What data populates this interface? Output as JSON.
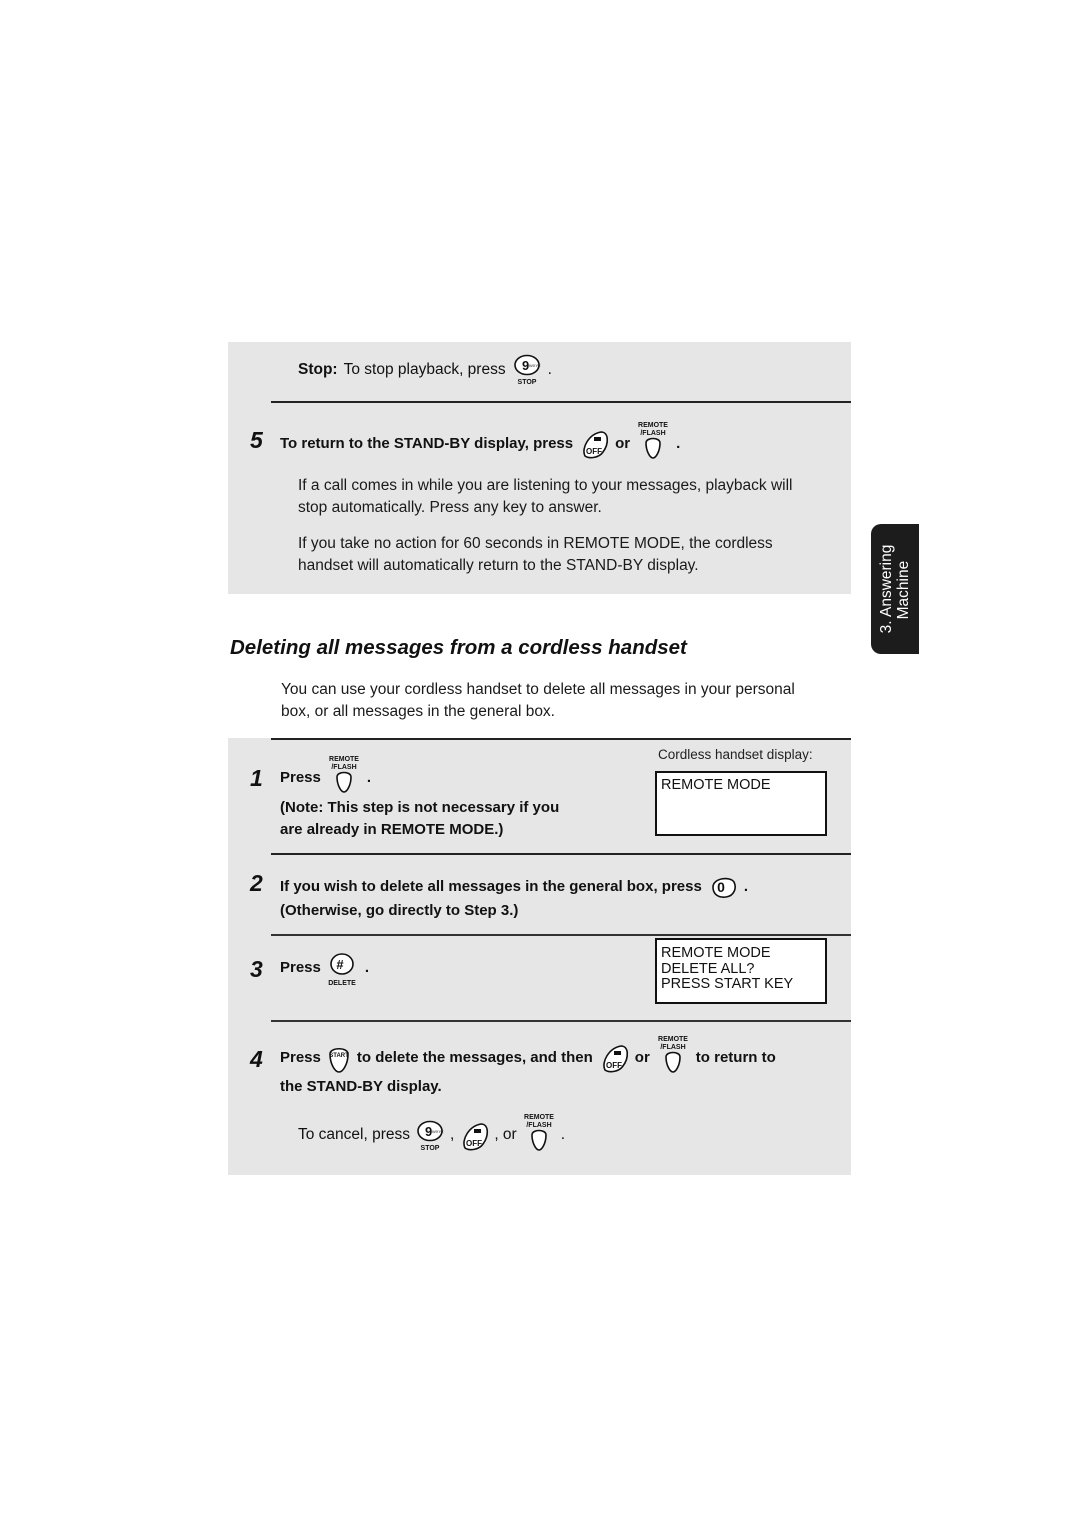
{
  "top_section": {
    "stop_label": "Stop:",
    "stop_text": "To stop playback, press",
    "period": ".",
    "step5": {
      "number": "5",
      "text": "To return to the STAND-BY display, press",
      "or": "or",
      "period": "."
    },
    "para1": [
      "If a call comes in while you are listening to your messages, playback will",
      "stop automatically. Press any key to answer."
    ],
    "para2": [
      "If you take no action for 60 seconds in REMOTE MODE, the cordless",
      "handset will automatically return to the STAND-BY display."
    ]
  },
  "side_tab": {
    "line1": "3. Answering",
    "line2": "Machine"
  },
  "section": {
    "title": "Deleting all messages from a cordless handset",
    "intro": [
      "You can use your cordless handset to delete all messages in your personal",
      "box, or all messages in the general box."
    ]
  },
  "display_caption": "Cordless handset display:",
  "steps": [
    {
      "number": "1",
      "press": "Press",
      "period": ".",
      "note": [
        "(Note: This step is not necessary if you",
        "are already in REMOTE MODE.)"
      ],
      "display": [
        "REMOTE MODE"
      ]
    },
    {
      "number": "2",
      "text": "If you wish to delete all messages in the general box, press",
      "period": ".",
      "note": "(Otherwise, go directly to Step 3.)"
    },
    {
      "number": "3",
      "press": "Press",
      "period": ".",
      "display": [
        "REMOTE MODE",
        "DELETE ALL?",
        "PRESS START KEY"
      ]
    },
    {
      "number": "4",
      "press": "Press",
      "text_a": "to delete the messages, and then",
      "or": "or",
      "text_b": "to return to",
      "line2": "the STAND-BY display.",
      "cancel_text": "To cancel, press",
      "comma": ",",
      "comma_or": ", or",
      "period": "."
    }
  ],
  "keys": {
    "stop": {
      "main": "9",
      "sub": "WXYZ",
      "label": "STOP"
    },
    "off": {
      "label": "OFF"
    },
    "remote_flash": {
      "line1": "REMOTE",
      "line2": "/FLASH"
    },
    "zero": {
      "label": "0"
    },
    "delete": {
      "main": "#",
      "label": "DELETE"
    },
    "start": {
      "label": "START"
    }
  }
}
